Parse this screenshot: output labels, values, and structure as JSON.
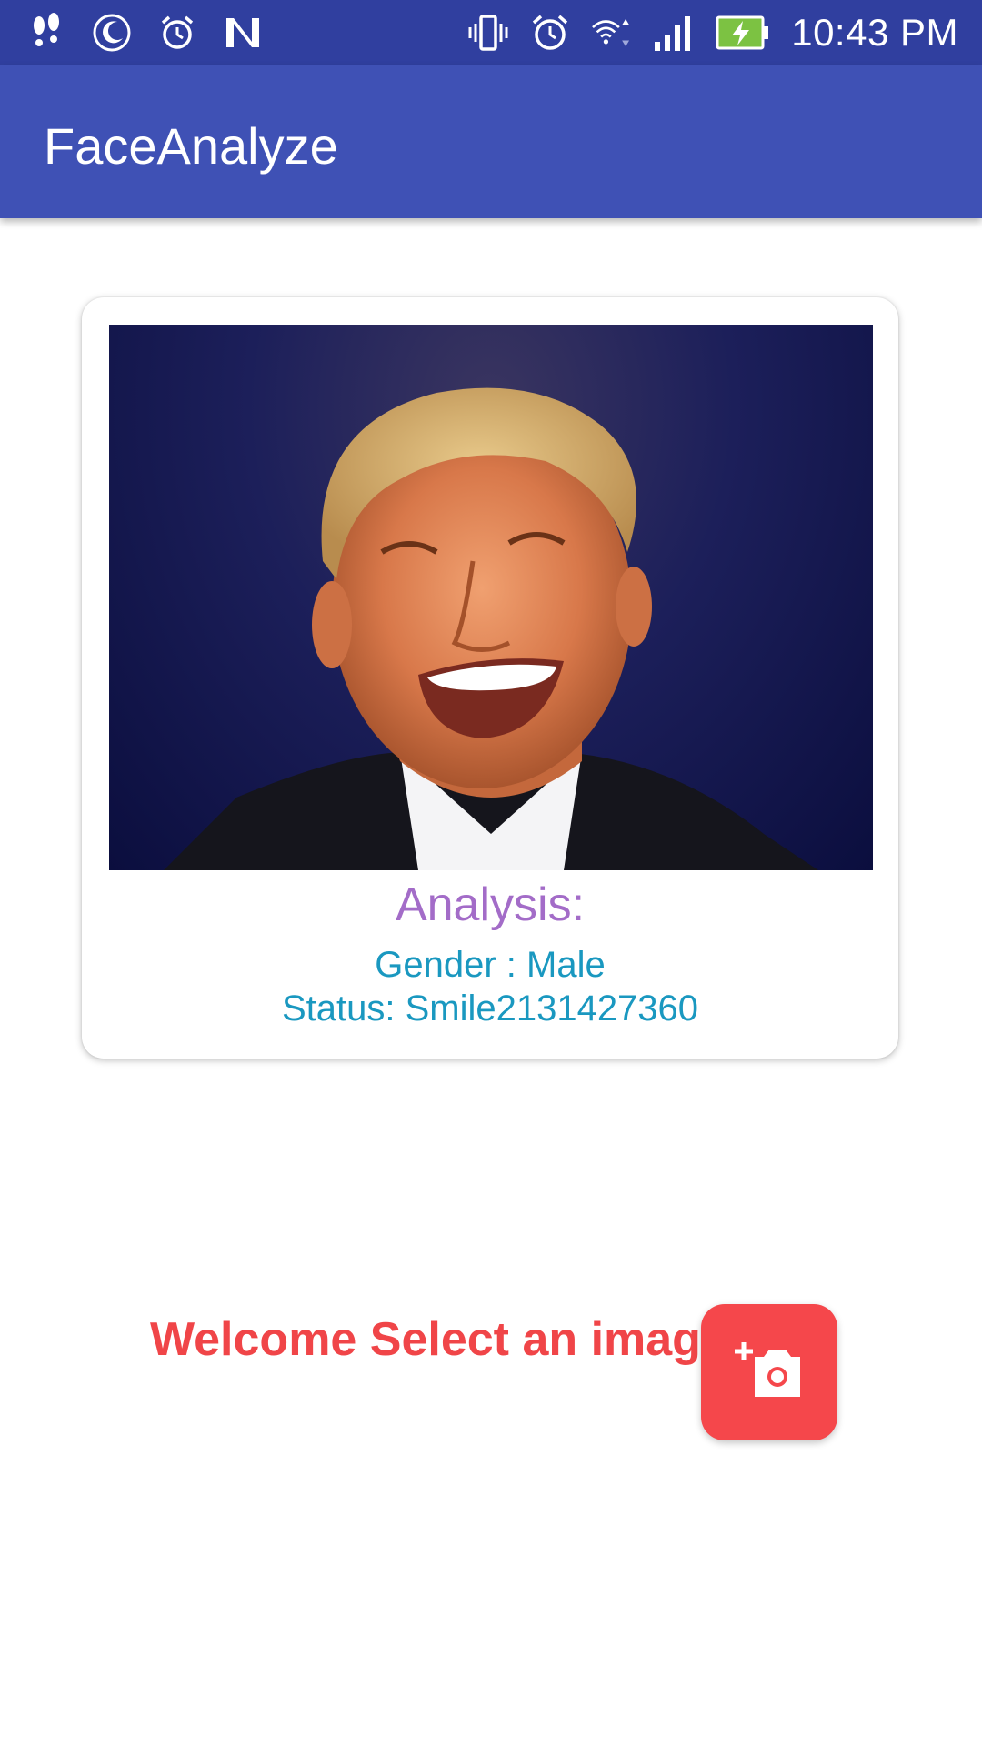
{
  "status_bar": {
    "left_icons": [
      "footprints-icon",
      "moon-icon",
      "alarm-clock-icon",
      "n-logo-icon"
    ],
    "right_icons": [
      "vibrate-icon",
      "alarm-icon",
      "wifi-icon",
      "signal-icon",
      "battery-charging-icon"
    ],
    "time": "10:43 PM"
  },
  "app_bar": {
    "title": "FaceAnalyze"
  },
  "card": {
    "image_icon": "face-photo",
    "analysis_title": "Analysis:",
    "gender_line": "Gender : Male",
    "status_line": "Status: Smile2131427360"
  },
  "welcome_text": "Welcome Select an image",
  "fab": {
    "icon": "add-camera-icon"
  },
  "colors": {
    "status_bar": "#303f9f",
    "app_bar": "#3f51b5",
    "analysis_title": "#a36cc8",
    "analysis_text": "#1a98c0",
    "welcome": "#f04548",
    "fab": "#f5474b"
  }
}
